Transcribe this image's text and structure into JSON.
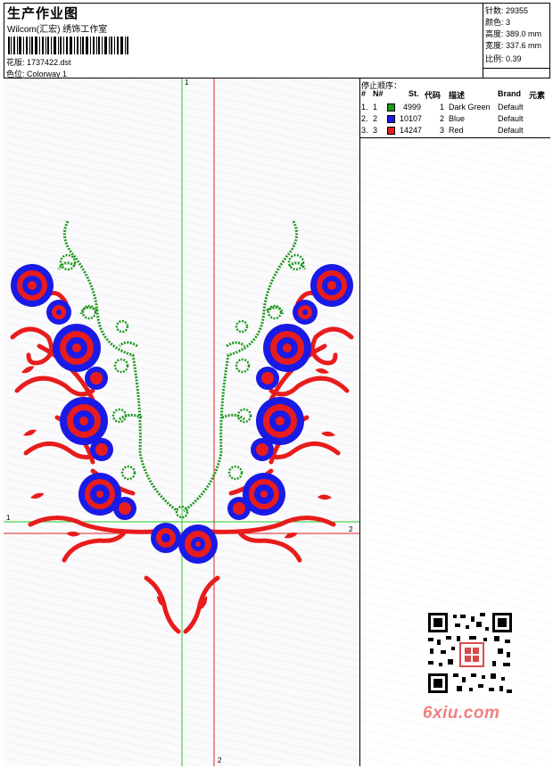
{
  "header": {
    "title": "生产作业图",
    "studio": "Wilcom(汇宏) 绣饰工作室",
    "pattern": "花版: 1737422.dst",
    "colorway": "色位: Colorway 1"
  },
  "stats": {
    "stitches": "针数: 29355",
    "colors": "颜色: 3",
    "height": "高度: 389.0 mm",
    "width": "宽度: 337.6 mm",
    "scale": "比例: 0.39"
  },
  "stop_sequence": {
    "title": "停止顺序：",
    "headers": [
      "#",
      "N#",
      "St.",
      "代码",
      "描述",
      "Brand",
      "元素"
    ],
    "rows": [
      {
        "idx": "1.",
        "needle": "1",
        "color": "#1f9a1f",
        "stitches": "4999",
        "code": "1",
        "desc": "Dark Green",
        "brand": "Default"
      },
      {
        "idx": "2.",
        "needle": "2",
        "color": "#1a1ae6",
        "stitches": "10107",
        "code": "2",
        "desc": "Blue",
        "brand": "Default"
      },
      {
        "idx": "3.",
        "needle": "3",
        "color": "#e81c1c",
        "stitches": "14247",
        "code": "3",
        "desc": "Red",
        "brand": "Default"
      }
    ]
  },
  "axes": {
    "v1": "1",
    "h1": "1",
    "h2": "2",
    "v2": "2"
  },
  "watermark": "6xiu.com",
  "colors": {
    "green": "#1f9a1f",
    "blue": "#1a1ae6",
    "red": "#e81c1c",
    "guide_green": "#22cc22",
    "guide_red": "#dd2222"
  }
}
